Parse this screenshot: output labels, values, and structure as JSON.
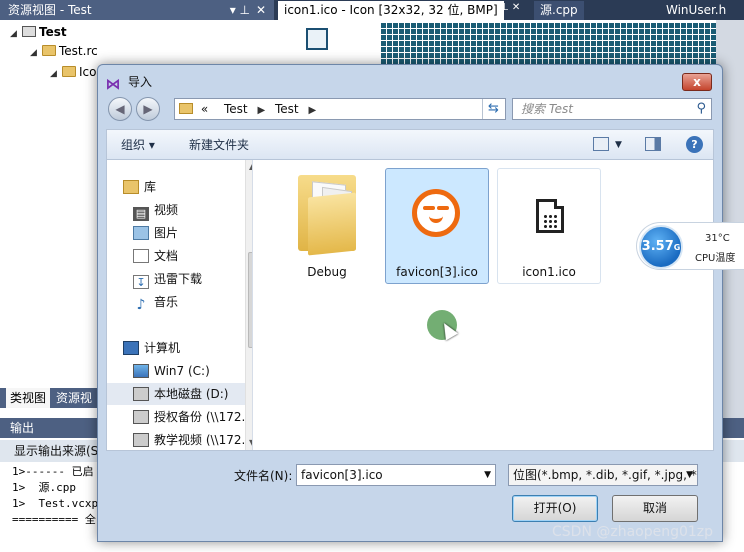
{
  "vs": {
    "pane_title": "资源视图 - Test",
    "tree": [
      "Test",
      "Test.rc",
      "Ico"
    ],
    "tabs": [
      "类视图",
      "资源视"
    ],
    "doc_tabs": [
      "icon1.ico - Icon [32x32, 32 位, BMP]",
      "源.cpp",
      "WinUser.h"
    ],
    "output": {
      "title": "输出",
      "source_label": "显示输出来源(S",
      "lines": [
        "1>------ 已启",
        "1>  源.cpp",
        "1>  Test.vcxp",
        "========== 全"
      ]
    }
  },
  "dialog": {
    "title": "导入",
    "close": "x",
    "address": [
      "«",
      "Test",
      "Test"
    ],
    "search_placeholder": "搜索 Test",
    "toolbar": {
      "organize": "组织 ▾",
      "new_folder": "新建文件夹"
    },
    "nav": [
      {
        "label": "库",
        "icon": "library-icon"
      },
      {
        "label": "视频",
        "icon": "video-icon"
      },
      {
        "label": "图片",
        "icon": "picture-icon"
      },
      {
        "label": "文档",
        "icon": "document-icon"
      },
      {
        "label": "迅雷下载",
        "icon": "download-icon"
      },
      {
        "label": "音乐",
        "icon": "music-icon"
      },
      {
        "label": "计算机",
        "icon": "computer-icon"
      },
      {
        "label": "Win7 (C:)",
        "icon": "drive-icon"
      },
      {
        "label": "本地磁盘 (D:)",
        "icon": "drive-icon"
      },
      {
        "label": "授权备份 (\\\\172.",
        "icon": "network-drive-icon"
      },
      {
        "label": "教学视频 (\\\\172.",
        "icon": "network-drive-icon"
      }
    ],
    "files": [
      {
        "name": "Debug",
        "kind": "folder"
      },
      {
        "name": "favicon[3].ico",
        "kind": "favicon",
        "selected": true
      },
      {
        "name": "icon1.ico",
        "kind": "icon"
      }
    ],
    "filename_label": "文件名(N):",
    "filename_value": "favicon[3].ico",
    "filetype_value": "位图(*.bmp, *.dib, *.gif, *.jpg, *",
    "open_button": "打开(O)",
    "cancel_button": "取消"
  },
  "widget": {
    "speed": "3.57",
    "speed_unit": "G",
    "temp": "31°C",
    "cpu_label": "CPU温度"
  },
  "watermark": "CSDN @zhaopeng01zp",
  "colors": {
    "accent": "#3b73b9",
    "favicon": "#ee6a10",
    "selection": "#cce8ff"
  }
}
